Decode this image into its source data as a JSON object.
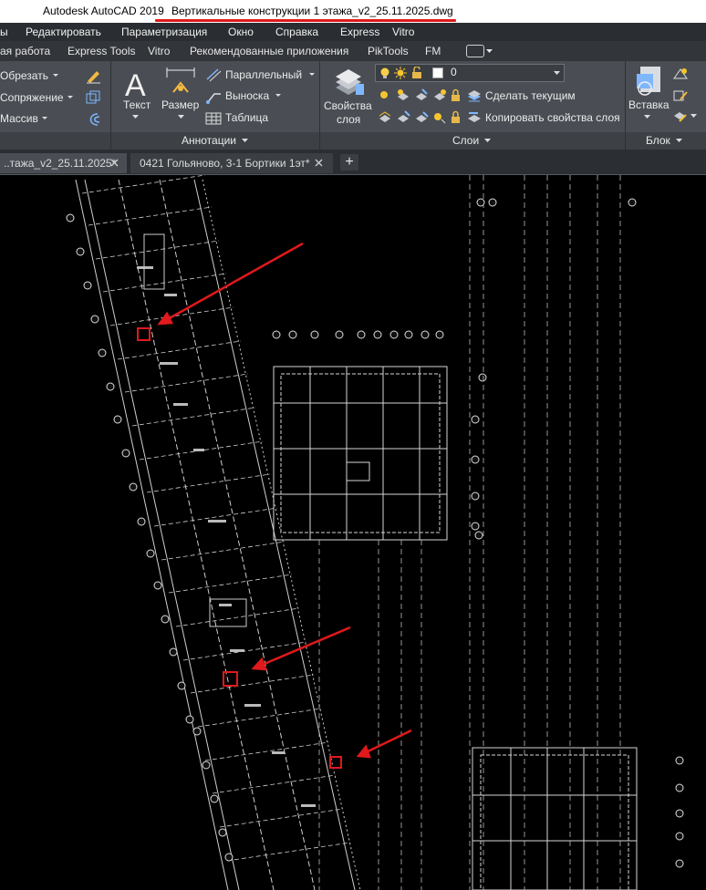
{
  "titlebar": {
    "app_name": "Autodesk AutoCAD 2019",
    "document_title": "Вертикальные конструкции 1 этажа_v2_25.11.2025.dwg"
  },
  "menubar": {
    "items": [
      "ы",
      "Редактировать",
      "Параметризация",
      "Окно",
      "Справка",
      "Express",
      "Vitro"
    ]
  },
  "ribbon_tabs": {
    "items": [
      "ая работа",
      "Express Tools",
      "Vitro",
      "Рекомендованные приложения",
      "PikTools",
      "FM"
    ]
  },
  "ribbon": {
    "modify": {
      "trim_label": "Обрезать",
      "fillet_label": "Сопряжение",
      "array_label": "Массив"
    },
    "annotation": {
      "text_label": "Текст",
      "dimension_label": "Размер",
      "linear_label": "Параллельный",
      "leader_label": "Выноска",
      "table_label": "Таблица",
      "panel_title": "Аннотации"
    },
    "layers": {
      "properties_label_line1": "Свойства",
      "properties_label_line2": "слоя",
      "current_layer": "0",
      "make_current_label": "Сделать текущим",
      "match_layer_label": "Копировать свойства слоя",
      "panel_title": "Слои"
    },
    "block": {
      "insert_label": "Вставка",
      "panel_title": "Блок"
    }
  },
  "file_tabs": {
    "tabs": [
      {
        "label": "..тажа_v2_25.11.2025*",
        "active": true
      },
      {
        "label": "0421 Гольяново, 3-1 Бортики 1эт*",
        "active": false
      }
    ]
  },
  "colors": {
    "highlight_red": "#e0191c",
    "drawing_background": "#000000",
    "ribbon_bg": "#4a4e54",
    "ribbon_text": "#eaeaea"
  }
}
